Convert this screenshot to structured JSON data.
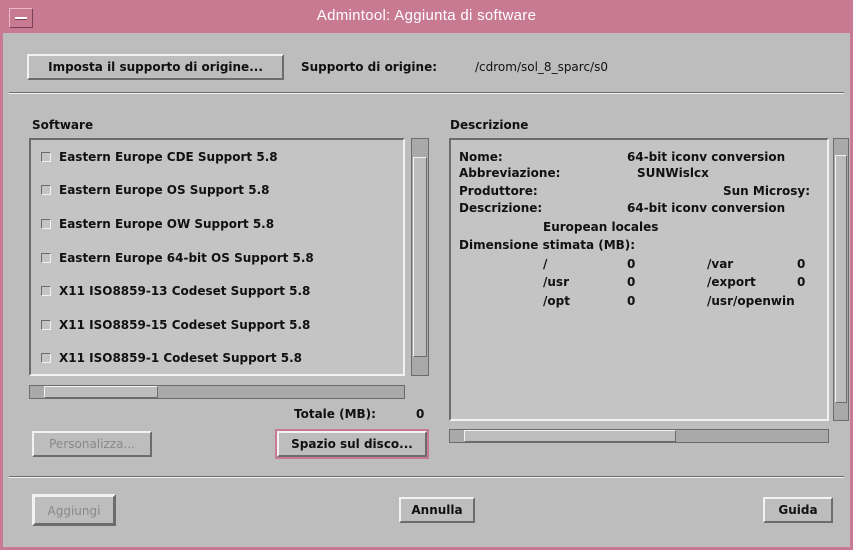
{
  "window": {
    "title": "Admintool: Aggiunta di software"
  },
  "source": {
    "set_source_button": "Imposta il supporto di origine...",
    "label": "Supporto di origine:",
    "path": "/cdrom/sol_8_sparc/s0"
  },
  "software": {
    "label": "Software",
    "items": [
      {
        "label": "Eastern Europe CDE Support 5.8",
        "checked": false
      },
      {
        "label": "Eastern Europe OS Support 5.8",
        "checked": false
      },
      {
        "label": "Eastern Europe OW Support 5.8",
        "checked": false
      },
      {
        "label": "Eastern Europe 64-bit OS Support 5.8",
        "checked": false
      },
      {
        "label": "X11 ISO8859-13 Codeset Support 5.8",
        "checked": false
      },
      {
        "label": "X11 ISO8859-15 Codeset Support 5.8",
        "checked": false
      },
      {
        "label": "X11 ISO8859-1 Codeset Support 5.8",
        "checked": false
      }
    ],
    "total_label": "Totale (MB):",
    "total_value": "0",
    "customize_button": "Personalizza...",
    "disk_space_button": "Spazio sul disco..."
  },
  "description": {
    "label": "Descrizione",
    "name_label": "Nome:",
    "name_value": "64-bit iconv conversion",
    "abbrev_label": "Abbreviazione:",
    "abbrev_value": "SUNWislcx",
    "producer_label": "Produttore:",
    "producer_value": "Sun Microsy:",
    "desc_label": "Descrizione:",
    "desc_value": "64-bit iconv conversion",
    "desc_value2": "European locales",
    "size_label": "Dimensione stimata (MB):",
    "sizes": [
      {
        "fs": "/",
        "mb": "0",
        "fs2": "/var",
        "mb2": "0"
      },
      {
        "fs": "/usr",
        "mb": "0",
        "fs2": "/export",
        "mb2": "0"
      },
      {
        "fs": "/opt",
        "mb": "0",
        "fs2": "/usr/openwin",
        "mb2": ""
      }
    ]
  },
  "footer": {
    "add_button": "Aggiungi",
    "cancel_button": "Annulla",
    "help_button": "Guida"
  },
  "colors": {
    "accent": "#c97a93",
    "background": "#bdbdbd"
  }
}
